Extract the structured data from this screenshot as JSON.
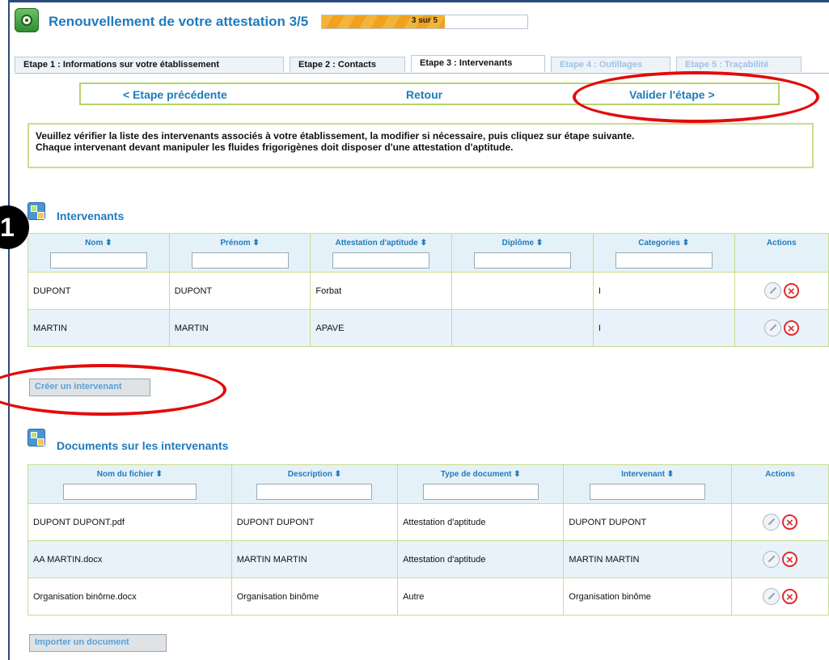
{
  "header": {
    "title": "Renouvellement de votre attestation 3/5",
    "progress_text": "3 sur 5",
    "progress_value": 0.6
  },
  "tabs": [
    {
      "label": "Etape 1 : Informations sur votre établissement",
      "state": "normal"
    },
    {
      "label": "Etape 2 : Contacts",
      "state": "normal"
    },
    {
      "label": "Etape 3 : Intervenants",
      "state": "active"
    },
    {
      "label": "Etape 4 : Outillages",
      "state": "disabled"
    },
    {
      "label": "Etape 5 : Traçabilité",
      "state": "disabled"
    }
  ],
  "stepnav": {
    "prev": "< Etape précédente",
    "back": "Retour",
    "validate": "Valider l'étape >"
  },
  "info": {
    "line1": "Veuillez vérifier la liste des intervenants associés à votre établissement, la modifier si nécessaire, puis cliquez sur étape suivante.",
    "line2": "Chaque intervenant devant manipuler les fluides frigorigènes doit disposer d'une attestation d'aptitude."
  },
  "callout_badge": "1",
  "intervenants": {
    "title": "Intervenants",
    "columns": [
      "Nom ⬍",
      "Prénom ⬍",
      "Attestation d'aptitude ⬍",
      "Diplôme ⬍",
      "Categories ⬍",
      "Actions"
    ],
    "rows": [
      [
        "DUPONT",
        "DUPONT",
        "Forbat",
        "",
        "I"
      ],
      [
        "MARTIN",
        "MARTIN",
        "APAVE",
        "",
        "I"
      ]
    ],
    "create_button": "Créer un intervenant"
  },
  "documents": {
    "title": "Documents sur les intervenants",
    "columns": [
      "Nom du fichier ⬍",
      "Description ⬍",
      "Type de document ⬍",
      "Intervenant ⬍",
      "Actions"
    ],
    "rows": [
      [
        "DUPONT DUPONT.pdf",
        "DUPONT DUPONT",
        "Attestation d'aptitude",
        "DUPONT DUPONT"
      ],
      [
        "AA MARTIN.docx",
        "MARTIN MARTIN",
        "Attestation d'aptitude",
        "MARTIN MARTIN"
      ],
      [
        "Organisation binôme.docx",
        "Organisation binôme",
        "Autre",
        "Organisation binôme"
      ]
    ],
    "import_button": "Importer un document"
  },
  "colors": {
    "accent": "#1f7bbd",
    "highlight": "#e30b0b",
    "table_border": "#c9de8c"
  }
}
